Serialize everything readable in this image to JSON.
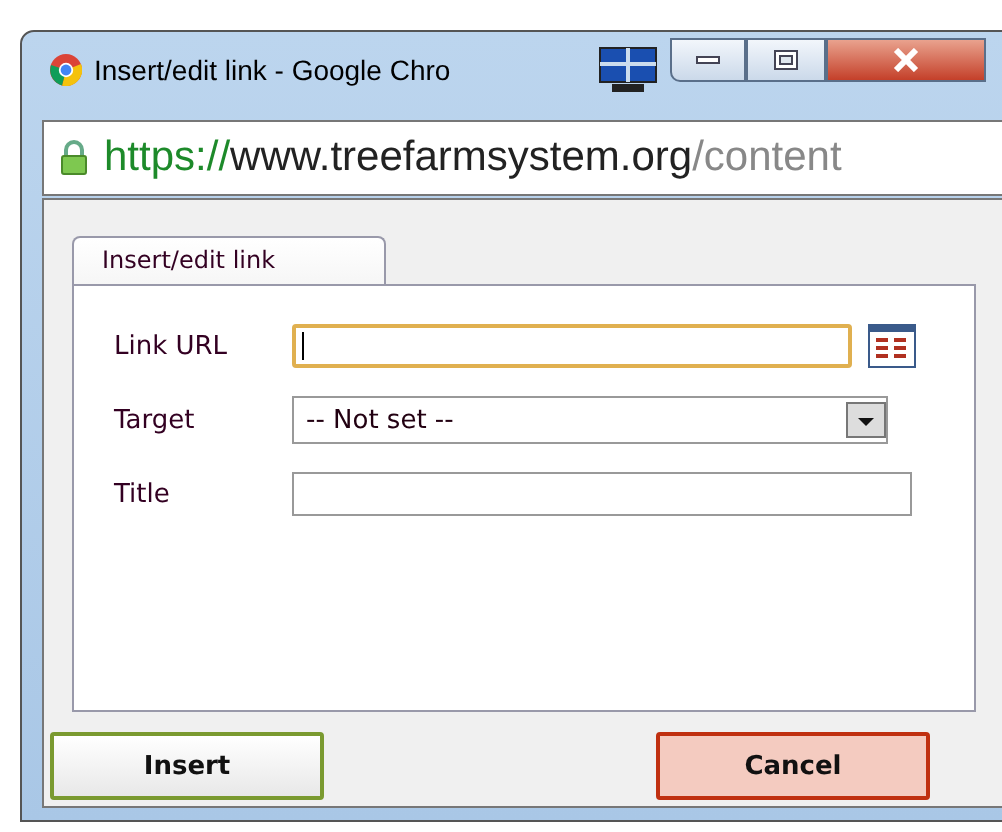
{
  "window": {
    "title": "Insert/edit link - Google Chro"
  },
  "address_bar": {
    "scheme": "https://",
    "host": "www.treefarmsystem.org",
    "path": "/content"
  },
  "tabs": [
    {
      "label": "Insert/edit link",
      "selected": true
    }
  ],
  "fields": [
    {
      "kind": "text",
      "label": "Link URL",
      "focused": true,
      "browse": true
    },
    {
      "kind": "select",
      "label": "Target",
      "value": "-- Not set --",
      "focused": false,
      "browse": false
    },
    {
      "kind": "text",
      "label": "Title",
      "focused": false,
      "browse": false
    }
  ],
  "buttons": [
    {
      "label": "Insert",
      "kind": "primary"
    },
    {
      "label": "Cancel",
      "kind": "cancel"
    }
  ]
}
